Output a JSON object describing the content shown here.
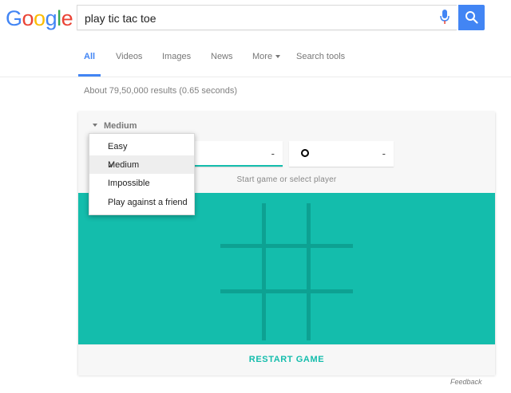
{
  "logo": {
    "letters": [
      "G",
      "o",
      "o",
      "g",
      "l",
      "e"
    ],
    "colors": [
      "#4285f4",
      "#ea4335",
      "#fbbc05",
      "#4285f4",
      "#34a853",
      "#ea4335"
    ]
  },
  "search": {
    "query": "play tic tac toe",
    "button_color": "#4285f4"
  },
  "tabs": [
    {
      "label": "All",
      "active": true
    },
    {
      "label": "Videos"
    },
    {
      "label": "Images"
    },
    {
      "label": "News"
    },
    {
      "label": "More"
    },
    {
      "label": "Search tools"
    }
  ],
  "results_stats": "About 79,50,000 results (0.65 seconds)",
  "game": {
    "difficulty_label": "Medium",
    "player_x_score": "-",
    "player_o_score": "-",
    "status_hint": "Start game or select player",
    "restart_label": "RESTART GAME",
    "board_color": "#14bdac",
    "grid_color": "#0da192"
  },
  "difficulty_menu": {
    "items": [
      {
        "label": "Easy"
      },
      {
        "label": "Medium",
        "selected": true
      },
      {
        "label": "Impossible"
      },
      {
        "label": "Play against a friend"
      }
    ]
  },
  "feedback": "Feedback"
}
